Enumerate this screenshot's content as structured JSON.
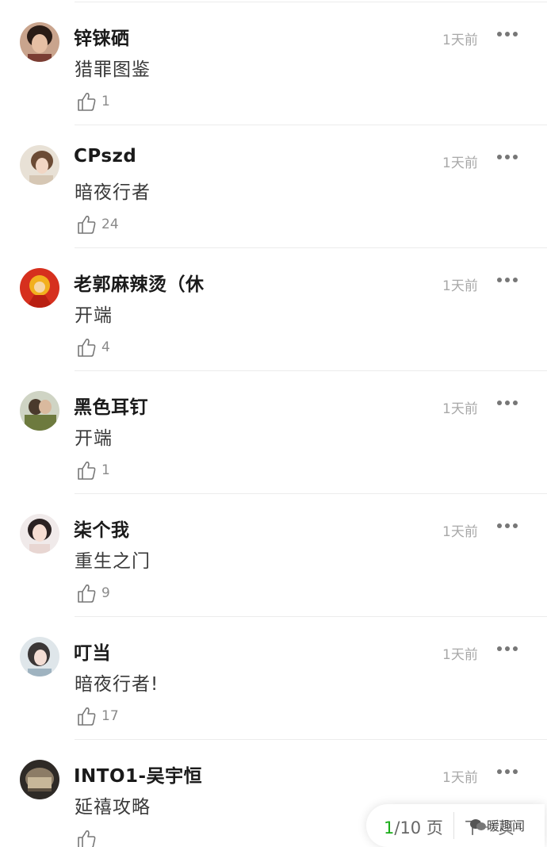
{
  "comments": [
    {
      "username": "锌铼硒",
      "time": "1天前",
      "text": "猎罪图鉴",
      "likes": "1"
    },
    {
      "username": "CPszd",
      "time": "1天前",
      "text": "暗夜行者",
      "likes": "24"
    },
    {
      "username": "老郭麻辣烫（休",
      "time": "1天前",
      "text": "开端",
      "likes": "4"
    },
    {
      "username": "黑色耳钉",
      "time": "1天前",
      "text": "开端",
      "likes": "1"
    },
    {
      "username": "柒个我",
      "time": "1天前",
      "text": "重生之门",
      "likes": "9"
    },
    {
      "username": "叮当",
      "time": "1天前",
      "text": "暗夜行者!",
      "likes": "17"
    },
    {
      "username": "INTO1-吴宇恒",
      "time": "1天前",
      "text": "延禧攻略",
      "likes": ""
    }
  ],
  "icons": {
    "like": "thumbs-up-icon",
    "more": "more-dots-icon"
  },
  "pager": {
    "current": "1",
    "total_label": "/10 页",
    "next_label": "下一页"
  },
  "watermark": {
    "label": "暖趣闻"
  },
  "colors": {
    "accent": "#1aad19",
    "time_gray": "#a8a8a8",
    "divider": "#ececec"
  }
}
